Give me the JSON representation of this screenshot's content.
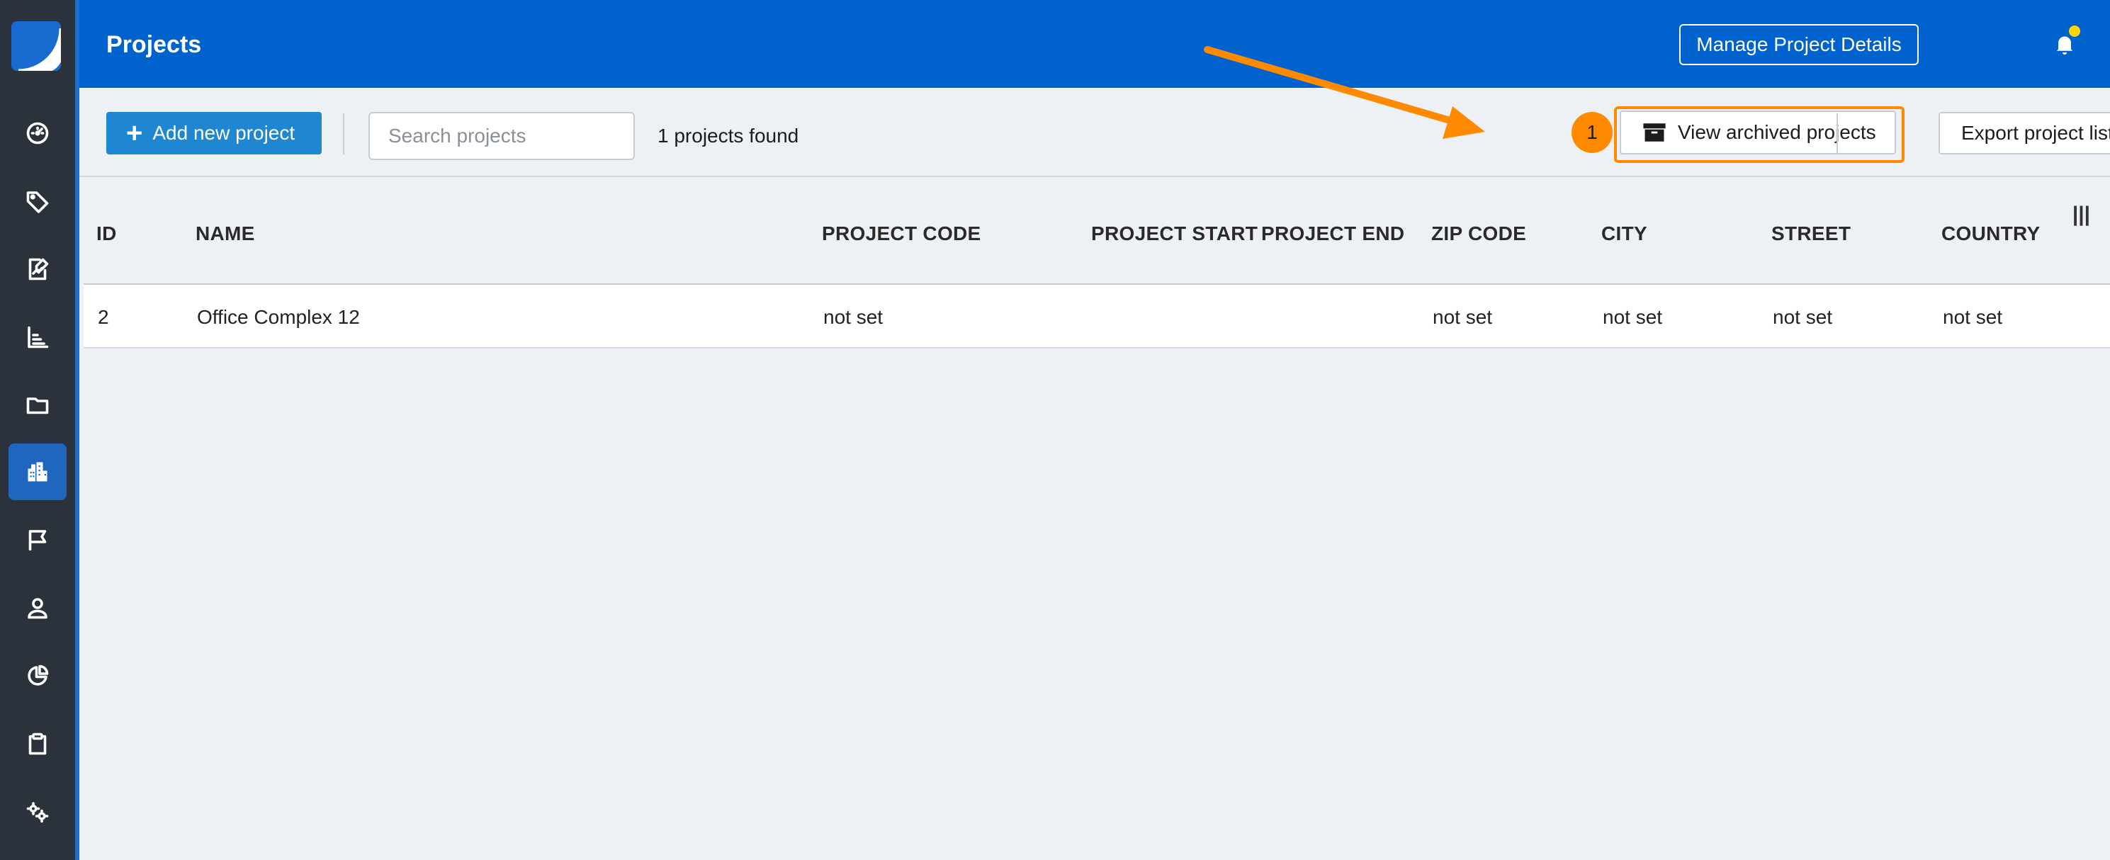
{
  "header": {
    "title": "Projects",
    "manage_label": "Manage Project Details"
  },
  "sidebar": {
    "items": [
      {
        "icon": "dashboard-icon"
      },
      {
        "icon": "tag-icon"
      },
      {
        "icon": "document-edit-icon"
      },
      {
        "icon": "chart-icon"
      },
      {
        "icon": "folder-icon"
      },
      {
        "icon": "buildings-icon",
        "active": true
      },
      {
        "icon": "flag-icon"
      },
      {
        "icon": "user-icon"
      },
      {
        "icon": "pie-chart-icon"
      },
      {
        "icon": "clipboard-icon"
      },
      {
        "icon": "settings-icon"
      }
    ]
  },
  "toolbar": {
    "add_label": "Add new project",
    "search_placeholder": "Search projects",
    "found_text": "1 projects found",
    "archive_label": "View archived projects",
    "export_label": "Export project list",
    "annotation_number": "1"
  },
  "table": {
    "columns": [
      "ID",
      "NAME",
      "PROJECT CODE",
      "PROJECT START",
      "PROJECT END",
      "ZIP CODE",
      "CITY",
      "STREET",
      "COUNTRY"
    ],
    "column_toggle": "|||",
    "rows": [
      {
        "id": "2",
        "name": "Office Complex 12",
        "project_code": "not set",
        "project_start": "",
        "project_end": "",
        "zip": "not set",
        "city": "not set",
        "street": "not set",
        "country": "not set"
      }
    ]
  },
  "colors": {
    "header_blue": "#0062cc",
    "sidebar_bg": "#2b323b",
    "accent_blue": "#1f87d2",
    "annotation_orange": "#ff8a00",
    "notification_dot": "#ffd600"
  }
}
